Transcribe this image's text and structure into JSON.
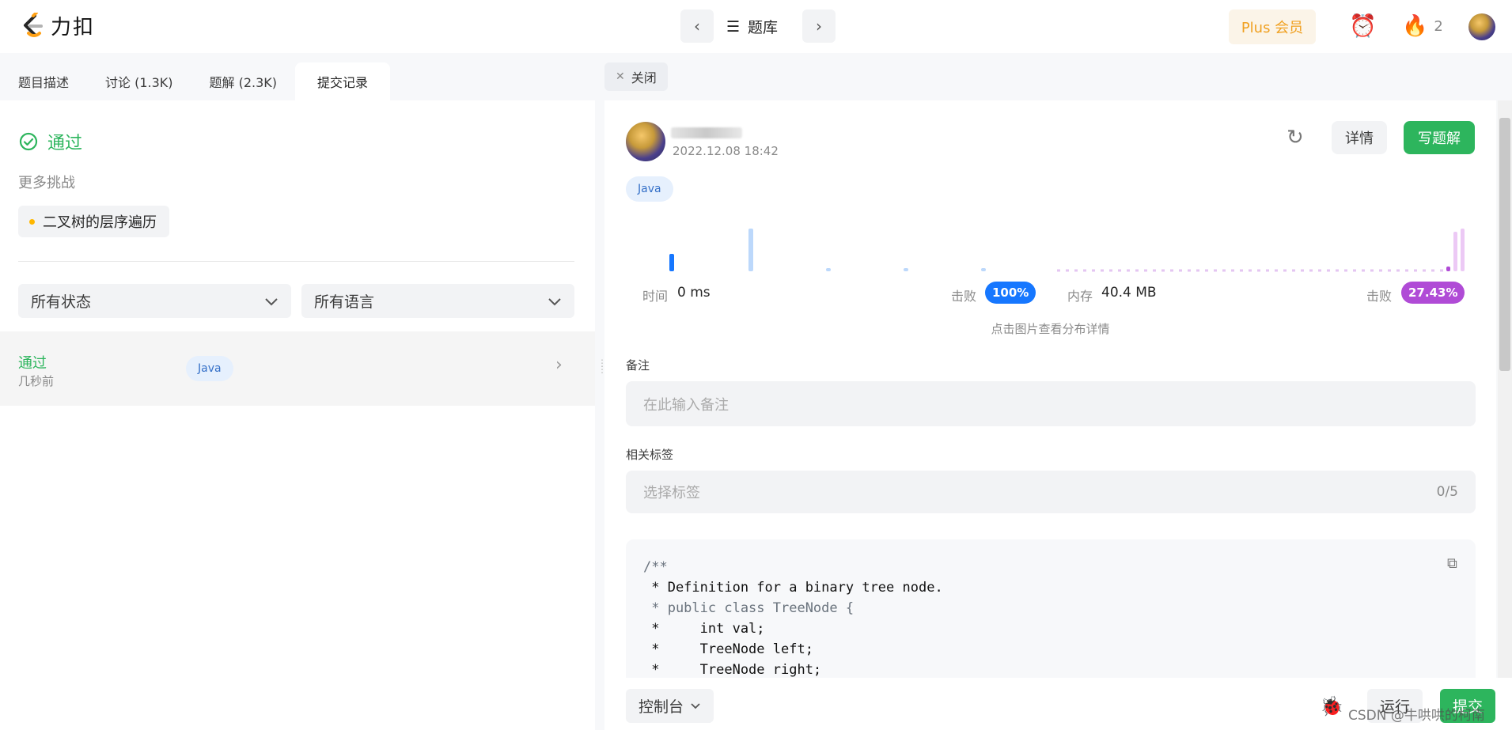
{
  "header": {
    "logo_text": "力扣",
    "problem_set_label": "题库",
    "plus_label": "Plus 会员",
    "streak_count": "2"
  },
  "tabs": [
    {
      "label": "题目描述",
      "active": false
    },
    {
      "label": "讨论 (1.3K)",
      "active": false
    },
    {
      "label": "题解 (2.3K)",
      "active": false
    },
    {
      "label": "提交记录",
      "active": true
    }
  ],
  "left": {
    "status": "通过",
    "more_challenges_label": "更多挑战",
    "challenge_chip": "二叉树的层序遍历",
    "filter_status": "所有状态",
    "filter_language": "所有语言",
    "submission": {
      "status": "通过",
      "time": "几秒前",
      "language": "Java"
    }
  },
  "right": {
    "close_tab_label": "关闭",
    "submit_time": "2022.12.08 18:42",
    "detail_button": "详情",
    "write_solution_button": "写题解",
    "language": "Java",
    "runtime_label": "时间",
    "runtime_value": "0 ms",
    "runtime_beat_label": "击败",
    "runtime_beat_value": "100%",
    "memory_label": "内存",
    "memory_value": "40.4 MB",
    "memory_beat_label": "击败",
    "memory_beat_value": "27.43%",
    "distribution_hint": "点击图片查看分布详情",
    "note_label": "备注",
    "note_placeholder": "在此输入备注",
    "tags_label": "相关标签",
    "tags_placeholder": "选择标签",
    "tags_count": "0/5",
    "code_lines": [
      {
        "text": "/**",
        "comment": true
      },
      {
        "text": " * Definition for a binary tree node.",
        "comment": false
      },
      {
        "text": " * public class TreeNode {",
        "comment": true
      },
      {
        "text": " *     int val;",
        "comment": false
      },
      {
        "text": " *     TreeNode left;",
        "comment": false
      },
      {
        "text": " *     TreeNode right;",
        "comment": false
      }
    ]
  },
  "bottom": {
    "console_label": "控制台",
    "run_label": "运行",
    "submit_label": "提交"
  },
  "watermark": "CSDN @牛哄哄的柯南",
  "colors": {
    "accent_green": "#2db55d",
    "runtime_blue": "#1677ff",
    "memory_purple": "#b04bd6",
    "plus_orange": "#f0a020"
  }
}
